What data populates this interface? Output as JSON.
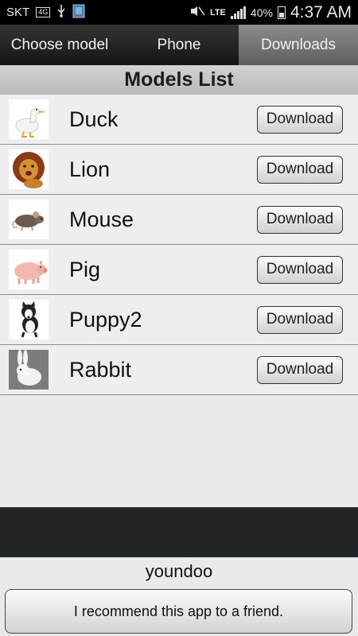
{
  "status_bar": {
    "carrier": "SKT",
    "network_badge": "4G",
    "network_type": "LTE",
    "battery_percent": "40%",
    "time": "4:37 AM"
  },
  "tabs": [
    {
      "label": "Choose model",
      "active": false
    },
    {
      "label": "Phone",
      "active": false
    },
    {
      "label": "Downloads",
      "active": true
    }
  ],
  "list_header": "Models List",
  "models": [
    {
      "name": "Duck",
      "button": "Download",
      "icon": "duck-thumbnail"
    },
    {
      "name": "Lion",
      "button": "Download",
      "icon": "lion-thumbnail"
    },
    {
      "name": "Mouse",
      "button": "Download",
      "icon": "mouse-thumbnail"
    },
    {
      "name": "Pig",
      "button": "Download",
      "icon": "pig-thumbnail"
    },
    {
      "name": "Puppy2",
      "button": "Download",
      "icon": "puppy-thumbnail"
    },
    {
      "name": "Rabbit",
      "button": "Download",
      "icon": "rabbit-thumbnail"
    }
  ],
  "footer": {
    "brand": "youndoo",
    "recommend_button": "I recommend this app to a friend."
  }
}
